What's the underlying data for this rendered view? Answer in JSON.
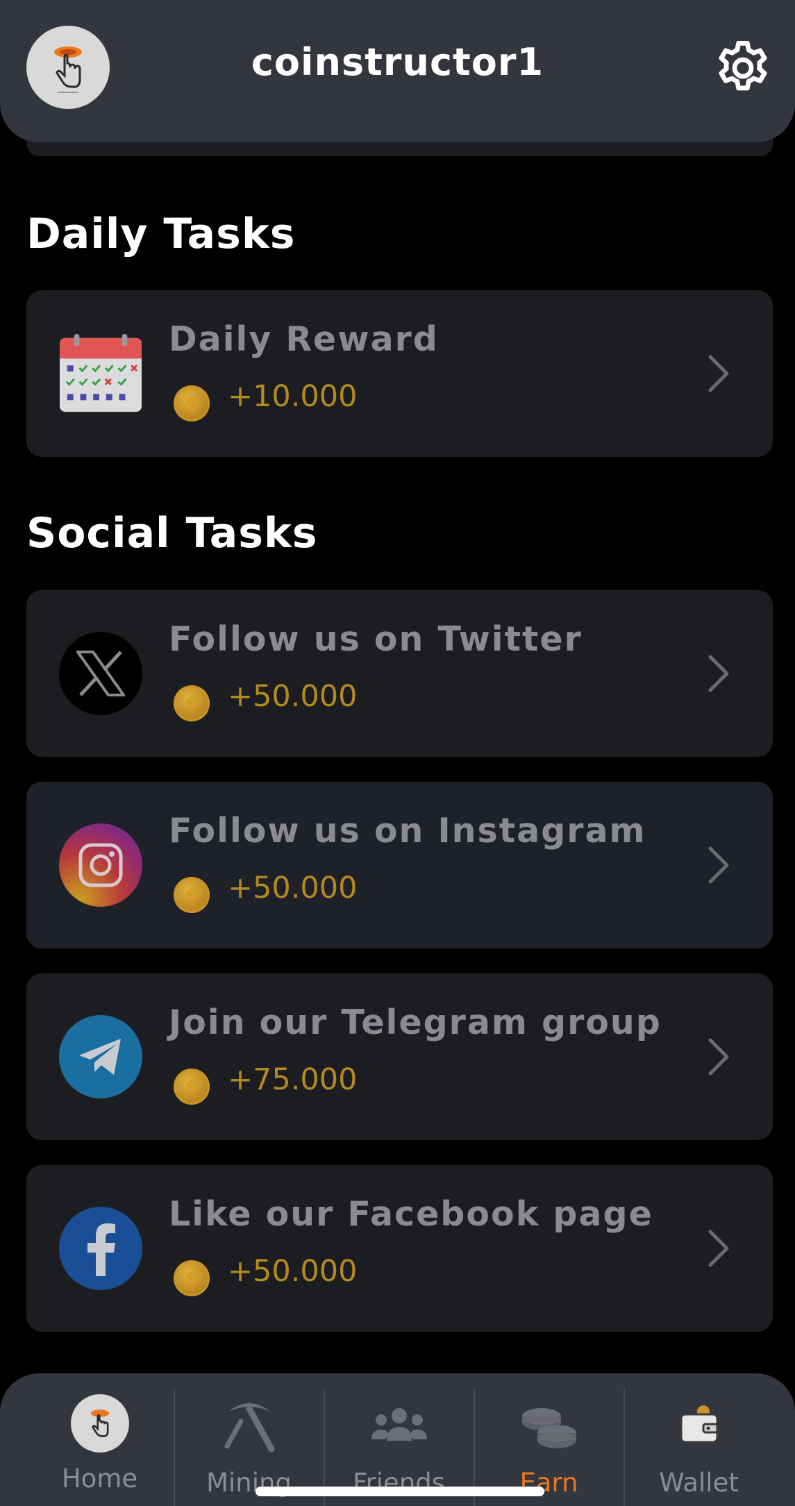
{
  "header": {
    "username": "coinstructor1",
    "avatar_icon": "tap-finger-logo-icon",
    "settings_icon": "gear-icon"
  },
  "daily_section": {
    "title": "Daily Tasks",
    "tasks": [
      {
        "label": "Daily Reward",
        "reward": "+10.000",
        "icon": "calendar-icon"
      }
    ]
  },
  "social_section": {
    "title": "Social Tasks",
    "tasks": [
      {
        "label": "Follow us on Twitter",
        "reward": "+50.000",
        "icon": "x-twitter-icon"
      },
      {
        "label": "Follow us on Instagram",
        "reward": "+50.000",
        "icon": "instagram-icon"
      },
      {
        "label": "Join our Telegram group",
        "reward": "+75.000",
        "icon": "telegram-icon"
      },
      {
        "label": "Like our Facebook page",
        "reward": "+50.000",
        "icon": "facebook-icon"
      }
    ]
  },
  "coin_symbol": "$",
  "nav": {
    "items": [
      {
        "label": "Home",
        "icon": "home-logo-icon",
        "active": false
      },
      {
        "label": "Mining",
        "icon": "pickaxe-icon",
        "active": false
      },
      {
        "label": "Friends",
        "icon": "friends-icon",
        "active": false
      },
      {
        "label": "Earn",
        "icon": "coins-icon",
        "active": true
      },
      {
        "label": "Wallet",
        "icon": "wallet-icon",
        "active": false
      }
    ]
  },
  "colors": {
    "background": "#000000",
    "header": "#33363f",
    "card": "#1c1d21",
    "reward_text": "#b38a20",
    "active_nav": "#e8781c"
  }
}
